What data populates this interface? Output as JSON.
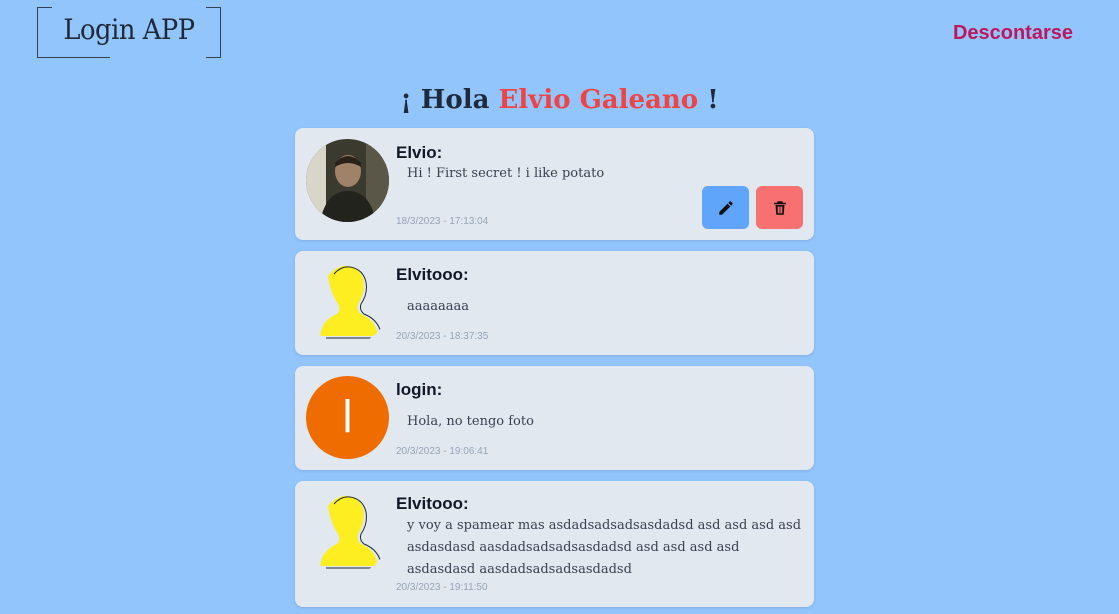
{
  "header": {
    "logo_text": "Login APP",
    "logout_label": "Descontarse"
  },
  "greeting": {
    "prefix": "¡ Hola",
    "name": "Elvio Galeano",
    "suffix": "!"
  },
  "posts": [
    {
      "author": "Elvio:",
      "message": "Hi ! First secret ! i like potato",
      "timestamp": "18/3/2023 - 17:13:04",
      "avatar": "photo"
    },
    {
      "author": "Elvitooo:",
      "message": "aaaaaaaa",
      "timestamp": "20/3/2023 - 18:37:35",
      "avatar": "default-user"
    },
    {
      "author": "login:",
      "message": "Hola, no tengo foto",
      "timestamp": "20/3/2023 - 19:06:41",
      "avatar": "letter",
      "avatar_letter": "l"
    },
    {
      "author": "Elvitooo:",
      "message": "y voy a spamear mas asdadsadsadsasdadsd asd asd asd asd asdasdasd aasdadsadsadsasdadsd asd asd asd asd asdasdasd aasdadsadsadsasdadsd",
      "timestamp": "20/3/2023 - 19:11:50",
      "avatar": "default-user"
    }
  ],
  "icons": {
    "edit": "pencil-icon",
    "delete": "trash-icon"
  },
  "colors": {
    "background": "#93c5fd",
    "card": "#e2e8f0",
    "logout": "#be185d",
    "name_accent": "#ef4444",
    "edit_button": "#60a5fa",
    "delete_button": "#f87171",
    "letter_avatar": "#ef6c00",
    "default_avatar": "#fcee21"
  }
}
